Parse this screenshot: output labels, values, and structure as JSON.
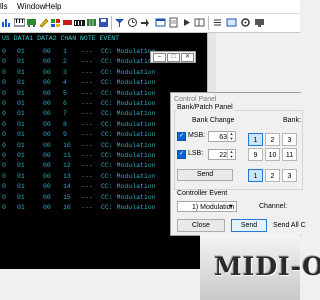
{
  "menu": [
    "lls",
    "Window",
    "Help"
  ],
  "toolbar": {
    "icons": [
      "bar-chart-icon",
      "keyboard-icon",
      "midi-cable-icon",
      "edit-icon",
      "color-icon",
      "record-icon",
      "piano-keys-icon",
      "grid-icon",
      "save-icon",
      "funnel-icon",
      "clock-icon",
      "arrow-icon",
      "window-icon",
      "document-icon",
      "play-icon",
      "layout-icon",
      "list-icon",
      "panel-icon",
      "settings-icon"
    ]
  },
  "monitor": {
    "header": "US DATA1 DATA2 CHAN NOTE EVENT",
    "rows": [
      {
        "c0": "0",
        "d1": "01",
        "d2": "00",
        "ch": "1",
        "note": "---",
        "event": "CC: Modulation"
      },
      {
        "c0": "0",
        "d1": "01",
        "d2": "00",
        "ch": "2",
        "note": "---",
        "event": "CC: Modulation"
      },
      {
        "c0": "0",
        "d1": "01",
        "d2": "00",
        "ch": "3",
        "note": "---",
        "event": "CC: Modulation"
      },
      {
        "c0": "0",
        "d1": "01",
        "d2": "00",
        "ch": "4",
        "note": "---",
        "event": "CC: Modulation"
      },
      {
        "c0": "0",
        "d1": "01",
        "d2": "00",
        "ch": "5",
        "note": "---",
        "event": "CC: Modulation"
      },
      {
        "c0": "0",
        "d1": "01",
        "d2": "00",
        "ch": "6",
        "note": "---",
        "event": "CC: Modulation"
      },
      {
        "c0": "0",
        "d1": "01",
        "d2": "00",
        "ch": "7",
        "note": "---",
        "event": "CC: Modulation"
      },
      {
        "c0": "0",
        "d1": "01",
        "d2": "00",
        "ch": "8",
        "note": "---",
        "event": "CC: Modulation"
      },
      {
        "c0": "0",
        "d1": "01",
        "d2": "00",
        "ch": "9",
        "note": "---",
        "event": "CC: Modulation"
      },
      {
        "c0": "0",
        "d1": "01",
        "d2": "00",
        "ch": "10",
        "note": "---",
        "event": "CC: Modulation"
      },
      {
        "c0": "0",
        "d1": "01",
        "d2": "00",
        "ch": "11",
        "note": "---",
        "event": "CC: Modulation"
      },
      {
        "c0": "0",
        "d1": "01",
        "d2": "00",
        "ch": "12",
        "note": "---",
        "event": "CC: Modulation"
      },
      {
        "c0": "0",
        "d1": "01",
        "d2": "00",
        "ch": "13",
        "note": "---",
        "event": "CC: Modulation"
      },
      {
        "c0": "0",
        "d1": "01",
        "d2": "00",
        "ch": "14",
        "note": "---",
        "event": "CC: Modulation"
      },
      {
        "c0": "0",
        "d1": "01",
        "d2": "00",
        "ch": "15",
        "note": "---",
        "event": "CC: Modulation"
      },
      {
        "c0": "0",
        "d1": "01",
        "d2": "00",
        "ch": "16",
        "note": "---",
        "event": "CC: Modulation"
      }
    ]
  },
  "control_panel": {
    "title": "Control Panel",
    "bank_patch_group": "Bank/Patch Panel",
    "bank_change": "Bank Change",
    "msb_label": "MSB:",
    "msb_value": "63",
    "lsb_label": "LSB:",
    "lsb_value": "22",
    "send_label": "Send",
    "bank_label": "Bank:",
    "bank_buttons_row1": [
      "1",
      "2",
      "3"
    ],
    "bank_buttons_row2": [
      "9",
      "10",
      "11"
    ],
    "bank_buttons_row3": [
      "1",
      "2",
      "3"
    ],
    "controller_event_label": "Controller Event",
    "controller_value": "1)  Modulation",
    "channel_label": "Channel:",
    "close_label": "Close",
    "send2_label": "Send",
    "send_all_label": "Send All C"
  },
  "logo_text": "MIDI-O"
}
